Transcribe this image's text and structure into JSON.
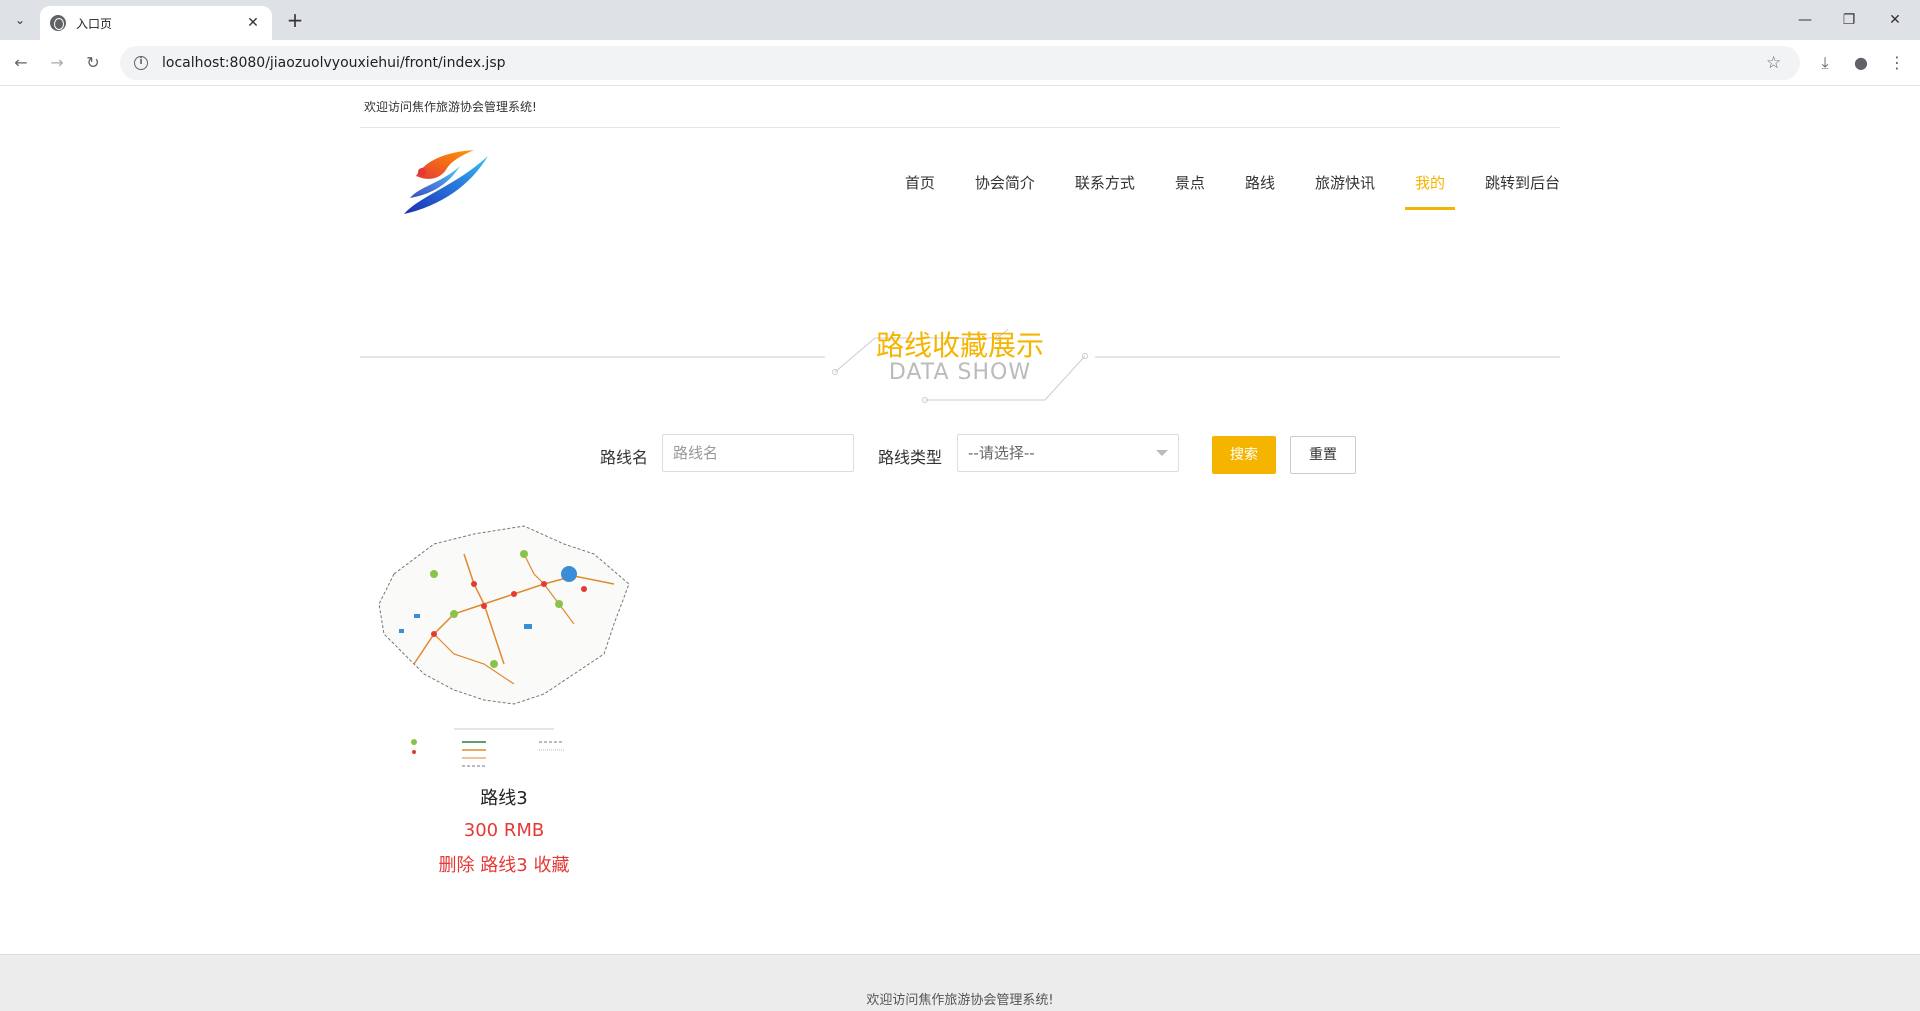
{
  "browser": {
    "tab_title": "入口页",
    "url": "localhost:8080/jiaozuolvyouxiehui/front/index.jsp"
  },
  "header": {
    "welcome": "欢迎访问焦作旅游协会管理系统!"
  },
  "nav": {
    "items": [
      "首页",
      "协会简介",
      "联系方式",
      "景点",
      "路线",
      "旅游快讯",
      "我的",
      "跳转到后台"
    ],
    "active_index": 6
  },
  "section": {
    "title_zh": "路线收藏展示",
    "title_en": "DATA SHOW"
  },
  "search": {
    "name_label": "路线名",
    "name_placeholder": "路线名",
    "type_label": "路线类型",
    "type_selected": "--请选择--",
    "search_button": "搜索",
    "reset_button": "重置"
  },
  "cards": [
    {
      "name": "路线3",
      "price": "300 RMB",
      "action": "删除 路线3 收藏"
    }
  ],
  "footer": {
    "text": "欢迎访问焦作旅游协会管理系统!"
  },
  "colors": {
    "accent": "#f5b400",
    "danger": "#e53935"
  }
}
